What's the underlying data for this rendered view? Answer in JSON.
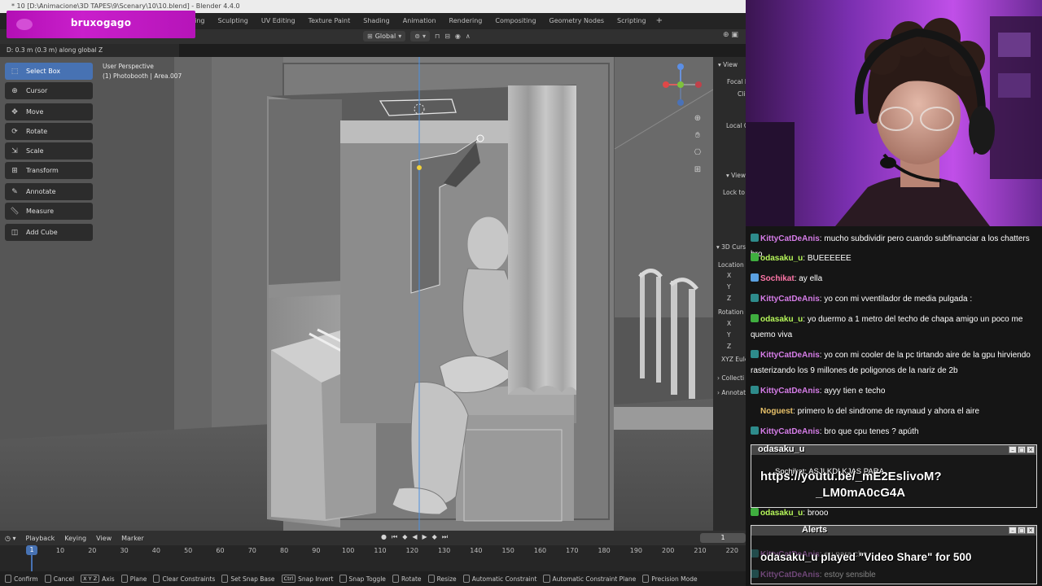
{
  "window": {
    "title": "* 10 [D:\\Animacione\\3D TAPES\\9\\Scenary\\10\\10.blend] - Blender 4.4.0"
  },
  "workspaces": [
    "Sculpting",
    "UV Editing",
    "Texture Paint",
    "Shading",
    "Animation",
    "Rendering",
    "Compositing",
    "Geometry Nodes",
    "Scripting"
  ],
  "workspace_partial": "ting",
  "workspace_add": "+",
  "stream_overlay": {
    "username": "bruxogago"
  },
  "viewport_header": {
    "orientation": "Global"
  },
  "operator_status": "D: 0.3 m (0.3 m) along global Z",
  "viewport_info": {
    "perspective": "User Perspective",
    "collection": "(1) Photobooth | Area.007"
  },
  "tools": [
    {
      "label": "Select Box",
      "icon": "select-box-icon",
      "active": true
    },
    {
      "label": "Cursor",
      "icon": "cursor-icon"
    },
    {
      "label": "Move",
      "icon": "move-icon"
    },
    {
      "label": "Rotate",
      "icon": "rotate-icon"
    },
    {
      "label": "Scale",
      "icon": "scale-icon"
    },
    {
      "label": "Transform",
      "icon": "transform-icon"
    },
    {
      "label": "Annotate",
      "icon": "annotate-icon"
    },
    {
      "label": "Measure",
      "icon": "measure-icon"
    },
    {
      "label": "Add Cube",
      "icon": "add-cube-icon"
    }
  ],
  "npanel": {
    "view": "View",
    "focal": "Focal L",
    "clip": "Cli",
    "local_camera": "Local C",
    "view2": "View",
    "lock": "Lock to",
    "cursor": "3D Curs",
    "location": "Location",
    "x": "X",
    "y": "Y",
    "z": "Z",
    "rotation": "Rotation",
    "rx": "X",
    "ry": "Y",
    "rz": "Z",
    "euler": "XYZ Eule",
    "collections": "Collecti",
    "annotations": "Annotat"
  },
  "timeline": {
    "menus": [
      "Playback",
      "Keying",
      "View",
      "Marker"
    ],
    "current_frame": "1",
    "frame_field": "1",
    "ticks": [
      "10",
      "20",
      "30",
      "40",
      "50",
      "60",
      "70",
      "80",
      "90",
      "100",
      "110",
      "120",
      "130",
      "140",
      "150",
      "160",
      "170",
      "180",
      "190",
      "200",
      "210",
      "220"
    ]
  },
  "statusbar": [
    {
      "key": "",
      "label": "Confirm"
    },
    {
      "key": "",
      "label": "Cancel"
    },
    {
      "key": "X Y Z",
      "label": "Axis"
    },
    {
      "key": "",
      "label": "Plane"
    },
    {
      "key": "",
      "label": "Clear Constraints"
    },
    {
      "key": "",
      "label": "Set Snap Base"
    },
    {
      "key": "Ctrl",
      "label": "Snap Invert"
    },
    {
      "key": "",
      "label": "Snap Toggle"
    },
    {
      "key": "",
      "label": "Rotate"
    },
    {
      "key": "",
      "label": "Resize"
    },
    {
      "key": "",
      "label": "Automatic Constraint"
    },
    {
      "key": "",
      "label": "Automatic Constraint Plane"
    },
    {
      "key": "",
      "label": "Precision Mode"
    }
  ],
  "chat": [
    {
      "user": "KittyCatDeAnis",
      "text": "mucho subdividir pero cuando subfinanciar a los chatters bro",
      "cls": "u-kitty",
      "badge": "#2e8b8b"
    },
    {
      "user": "odasaku_u",
      "text": "BUEEEEEE",
      "cls": "u-oda",
      "badge": "#3fae3f"
    },
    {
      "user": "Sochikat",
      "text": "ay ella",
      "cls": "u-soch",
      "badge": "#5aa0e0"
    },
    {
      "user": "KittyCatDeAnis",
      "text": "yo con mi vventilador de media pulgada :",
      "cls": "u-kitty",
      "badge": "#2e8b8b"
    },
    {
      "user": "odasaku_u",
      "text": "yo duermo a 1 metro del techo de chapa amigo un poco me quemo viva",
      "cls": "u-oda",
      "badge": "#3fae3f"
    },
    {
      "user": "KittyCatDeAnis",
      "text": "yo con mi cooler de la pc tirtando aire de la gpu hirviendo rasterizando los 9 millones de poligonos de la nariz de 2b",
      "cls": "u-kitty",
      "badge": "#2e8b8b"
    },
    {
      "user": "KittyCatDeAnis",
      "text": "ayyy tien e techo",
      "cls": "u-kitty",
      "badge": "#2e8b8b"
    },
    {
      "user": "Noguest",
      "text": "primero lo del sindrome de raynaud y ahora el aire",
      "cls": "u-nog",
      "badge": ""
    },
    {
      "user": "KittyCatDeAnis",
      "text": "bro que cpu tenes ? apúth",
      "cls": "u-kitty",
      "badge": "#2e8b8b"
    },
    {
      "user": "odasaku_u",
      "text": "brooo",
      "cls": "u-oda",
      "badge": "#3fae3f"
    },
    {
      "user": "KittyCatDeAnis",
      "text": "eu para che",
      "cls": "u-kitty",
      "badge": "#2e8b8b"
    },
    {
      "user": "KittyCatDeAnis",
      "text": "estoy sensible",
      "cls": "u-kitty",
      "badge": "#2e8b8b"
    }
  ],
  "alerts": {
    "box1_title": "odasaku_u",
    "box1_line": "https://youtu.be/_mE2EslivoM?",
    "box1_line2": "_LM0mA0cG4A",
    "box1_under": "Sochikat: ASJLKDLKJAS PARA",
    "box2_title": "Alerts",
    "box2_line": "odasaku_u played \"Video Share\" for 500"
  }
}
